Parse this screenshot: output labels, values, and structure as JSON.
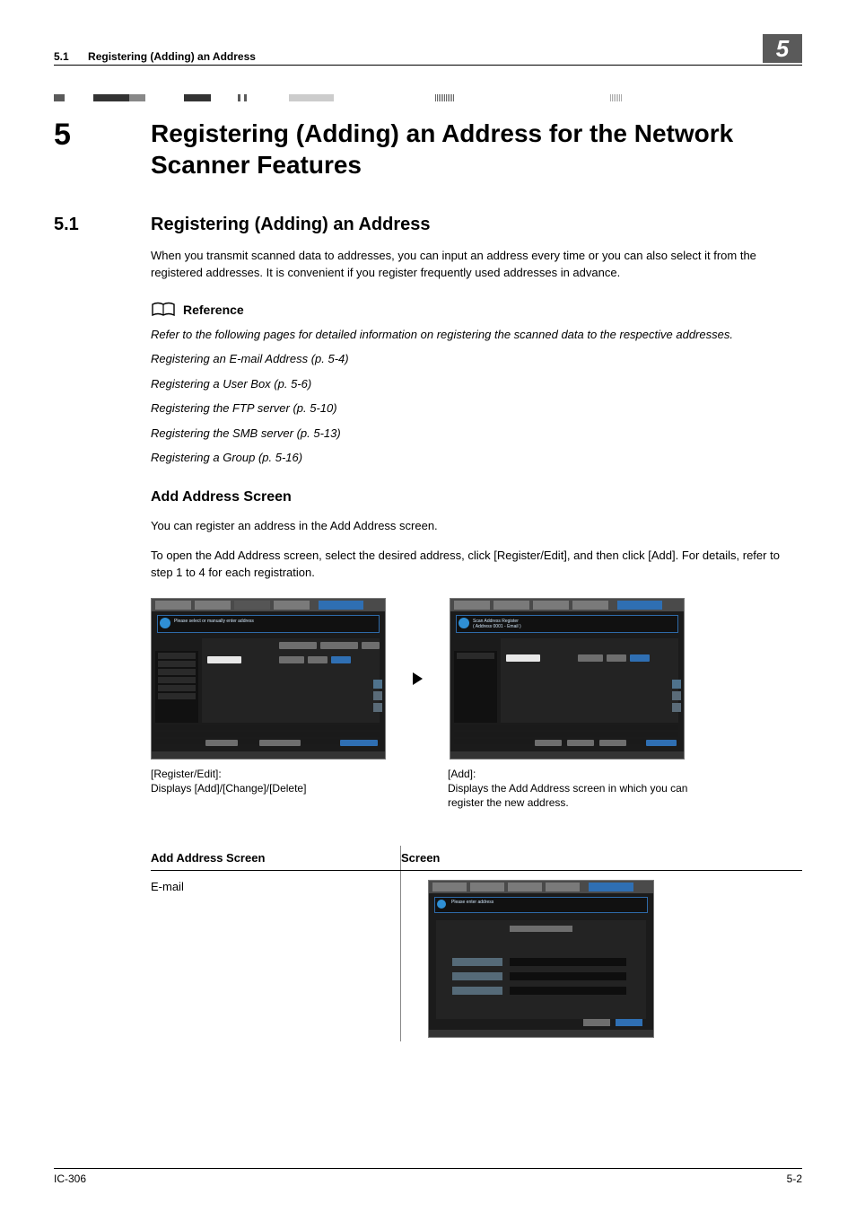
{
  "header": {
    "section_number": "5.1",
    "section_title": "Registering (Adding) an Address",
    "chapter_badge": "5"
  },
  "chapter": {
    "number": "5",
    "title": "Registering (Adding) an Address for the Network Scanner Features"
  },
  "section": {
    "number": "5.1",
    "title": "Registering (Adding) an Address",
    "intro": "When you transmit scanned data to addresses, you can input an address every time or you can also select it from the registered addresses.  It is convenient if you register frequently used addresses in advance."
  },
  "reference": {
    "heading": "Reference",
    "lead": "Refer to the following pages for detailed information on registering the scanned data to the respective addresses.",
    "items": [
      "Registering an E-mail Address (p. 5-4)",
      "Registering a User Box (p. 5-6)",
      "Registering the FTP server (p. 5-10)",
      "Registering the SMB server (p. 5-13)",
      "Registering a Group (p. 5-16)"
    ]
  },
  "add_address": {
    "heading": "Add Address Screen",
    "p1": "You can register an address in the Add Address screen.",
    "p2": "To open the Add Address screen, select the desired address, click [Register/Edit], and then click [Add]. For details, refer to step 1 to 4 for each registration."
  },
  "fig": {
    "left": {
      "label": "[Register/Edit]:",
      "desc": "Displays [Add]/[Change]/[Delete]"
    },
    "right": {
      "label": "[Add]:",
      "desc": "Displays the Add Address screen in which you can register the new address."
    }
  },
  "table": {
    "col1": "Add Address Screen",
    "col2": "Screen",
    "row1": "E-mail"
  },
  "footer": {
    "left": "IC-306",
    "right": "5-2"
  }
}
